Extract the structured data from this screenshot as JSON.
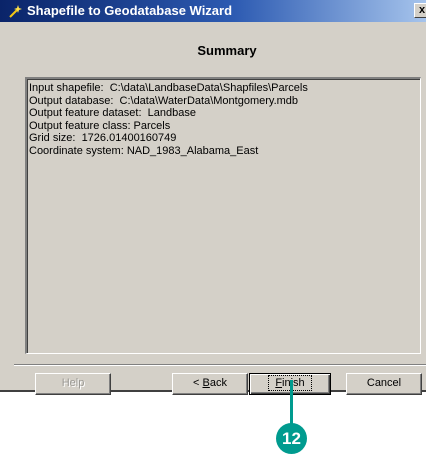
{
  "window": {
    "title": "Shapefile to Geodatabase Wizard",
    "close_glyph": "x",
    "title_icon": "wizard-sparkle-icon",
    "close_icon": "close-icon"
  },
  "page": {
    "heading": "Summary"
  },
  "summary": {
    "lines": [
      "Input shapefile:  C:\\data\\LandbaseData\\Shapfiles\\Parcels",
      "Output database:  C:\\data\\WaterData\\Montgomery.mdb",
      "Output feature dataset:  Landbase",
      "Output feature class: Parcels",
      "Grid size:  1726.01400160749",
      "Coordinate system: NAD_1983_Alabama_East"
    ]
  },
  "buttons": {
    "help": {
      "label": "Help",
      "enabled": false
    },
    "back": {
      "prefix": "< ",
      "mnemonic": "B",
      "rest": "ack",
      "enabled": true
    },
    "finish": {
      "mnemonic": "F",
      "rest": "inish",
      "enabled": true,
      "default": true
    },
    "cancel": {
      "label": "Cancel",
      "enabled": true
    }
  },
  "callout": {
    "number": "12",
    "color": "#009b8f"
  }
}
